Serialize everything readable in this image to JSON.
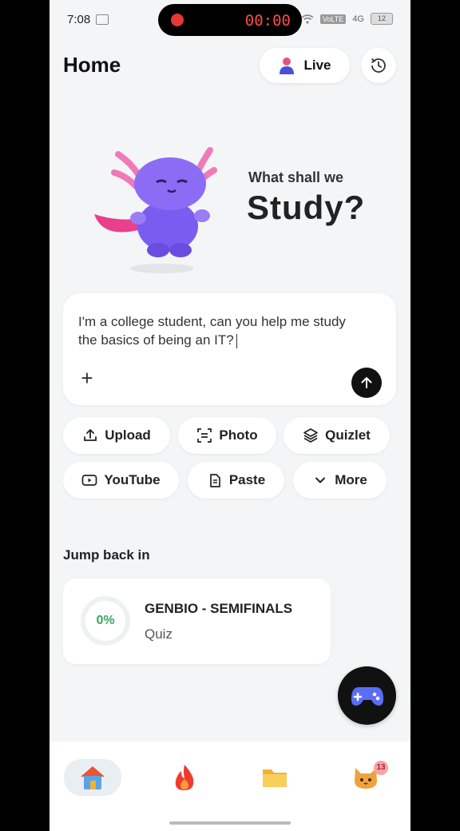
{
  "status_bar": {
    "time": "7:08",
    "recording_time": "00:00",
    "carrier_badge": "VoLTE",
    "network": "4G",
    "battery": "12"
  },
  "header": {
    "title": "Home",
    "live_label": "Live"
  },
  "hero": {
    "subtitle": "What shall we",
    "headline": "Study?"
  },
  "prompt": {
    "text": "I'm a college student, can you help me study the basics of being an IT?",
    "plus_label": "+"
  },
  "actions": [
    {
      "label": "Upload",
      "icon": "upload-icon"
    },
    {
      "label": "Photo",
      "icon": "scan-icon"
    },
    {
      "label": "Quizlet",
      "icon": "layers-icon"
    },
    {
      "label": "YouTube",
      "icon": "youtube-icon"
    },
    {
      "label": "Paste",
      "icon": "clipboard-icon"
    },
    {
      "label": "More",
      "icon": "chevron-down-icon"
    }
  ],
  "jump_back": {
    "section_title": "Jump back in",
    "items": [
      {
        "title": "GENBIO - SEMIFINALS",
        "type": "Quiz",
        "progress_text": "0%",
        "progress": 0
      }
    ]
  },
  "bottom_nav": {
    "items": [
      {
        "icon": "home-icon",
        "active": true
      },
      {
        "icon": "fire-icon",
        "active": false
      },
      {
        "icon": "folder-icon",
        "active": false
      },
      {
        "icon": "cat-icon",
        "active": false,
        "badge": "13"
      }
    ]
  },
  "colors": {
    "background": "#f4f5f7",
    "accent_green": "#3aa55f",
    "recording_red": "#e53935",
    "dark": "#111111"
  }
}
